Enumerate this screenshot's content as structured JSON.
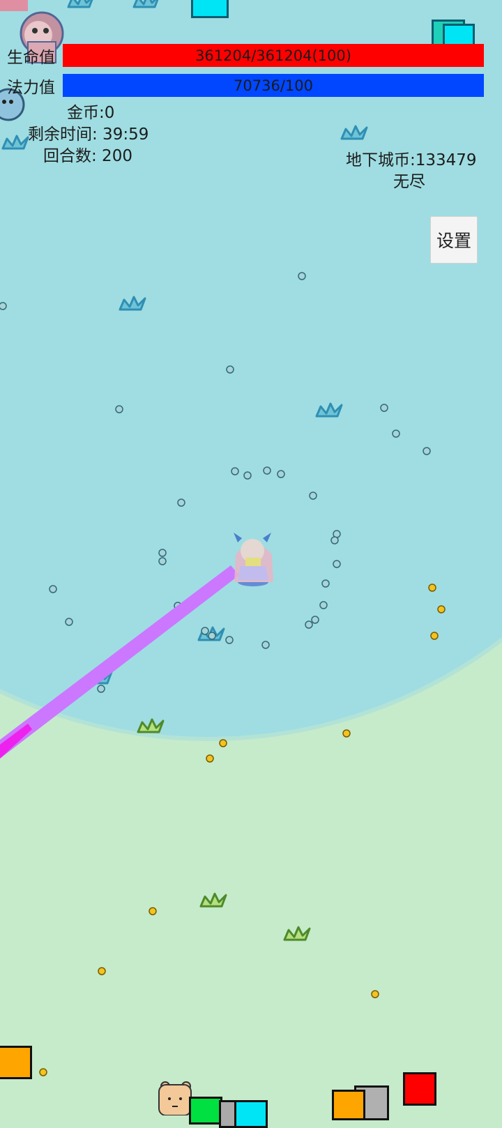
{
  "hud": {
    "hp_label": "生命值",
    "hp_text": "361204/361204(100)",
    "hp_fill": 1.0,
    "mp_label": "法力值",
    "mp_text": "70736/100",
    "mp_fill": 1.0,
    "gold_label": "金币:0",
    "time_label": "剩余时间:  39:59",
    "round_label": "回合数:  200",
    "dungeon_coin_label": "地下城币:133479",
    "mode_label": "无尽",
    "settings_label": "设置"
  },
  "colors": {
    "grass_light": "#c6ebcb",
    "water_zone": "#9fdde2",
    "hp_bar": "#ff0000",
    "mp_bar": "#0047ff",
    "laser": "#cc77ff",
    "laser_core": "#ee22ee",
    "gold_dot": "#f2c420",
    "xp_dot": "#a8d3d8",
    "grass_tuft_blue": "#2f8fb3",
    "grass_tuft_green": "#6aa83a"
  },
  "icons": {
    "player": "pixel-girl-with-horns",
    "enemy": "pixel-monkey",
    "slime": "blue-slime",
    "bear": "pixel-bear",
    "tuft": "grass-tuft-icon"
  }
}
